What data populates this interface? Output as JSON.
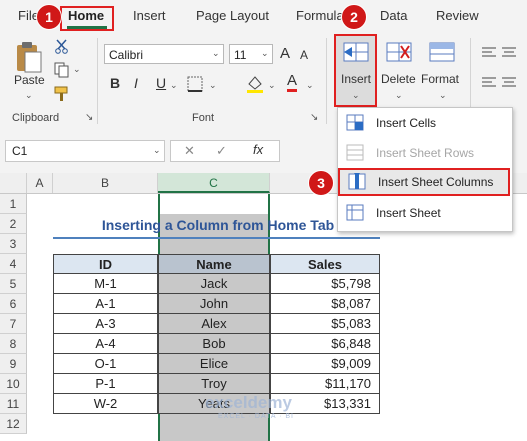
{
  "ribbon": {
    "tabs": [
      "File",
      "Home",
      "Insert",
      "Page Layout",
      "Formulas",
      "Data",
      "Review"
    ],
    "paste_label": "Paste",
    "clipboard_label": "Clipboard",
    "font_label": "Font",
    "font_name": "Calibri",
    "font_size": "11",
    "font_grow": "A",
    "font_shrink": "A",
    "bold": "B",
    "italic": "I",
    "underline": "U",
    "font_color_glyph": "A",
    "insert_label": "Insert",
    "delete_label": "Delete",
    "format_label": "Format"
  },
  "badges": [
    "1",
    "2",
    "3"
  ],
  "formula_bar": {
    "name_box": "C1",
    "fx": "fx"
  },
  "insert_menu": {
    "items": [
      {
        "label": "Insert Cells",
        "enabled": true,
        "highlighted": false
      },
      {
        "label": "Insert Sheet Rows",
        "enabled": false,
        "highlighted": false
      },
      {
        "label": "Insert Sheet Columns",
        "enabled": true,
        "highlighted": true
      },
      {
        "label": "Insert Sheet",
        "enabled": true,
        "highlighted": false
      }
    ]
  },
  "grid": {
    "columns": [
      "A",
      "B",
      "C"
    ],
    "rows": [
      "1",
      "2",
      "3",
      "4",
      "5",
      "6",
      "7",
      "8",
      "9",
      "10",
      "11",
      "12"
    ],
    "title": "Inserting a Column from Home Tab",
    "headers": [
      "ID",
      "Name",
      "Sales"
    ],
    "data": [
      [
        "M-1",
        "Jack",
        "$5,798"
      ],
      [
        "A-1",
        "John",
        "$8,087"
      ],
      [
        "A-3",
        "Alex",
        "$5,083"
      ],
      [
        "A-4",
        "Bob",
        "$6,848"
      ],
      [
        "O-1",
        "Elice",
        "$9,009"
      ],
      [
        "P-1",
        "Troy",
        "$11,170"
      ],
      [
        "W-2",
        "Yeats",
        "$13,331"
      ]
    ],
    "watermark": "exceldemy",
    "watermark_sub": "EXCEL · DATA · BI"
  },
  "colors": {
    "accent": "#217346",
    "highlight": "#e02020",
    "title": "#2e5597",
    "selection": "#c8c8c8"
  }
}
